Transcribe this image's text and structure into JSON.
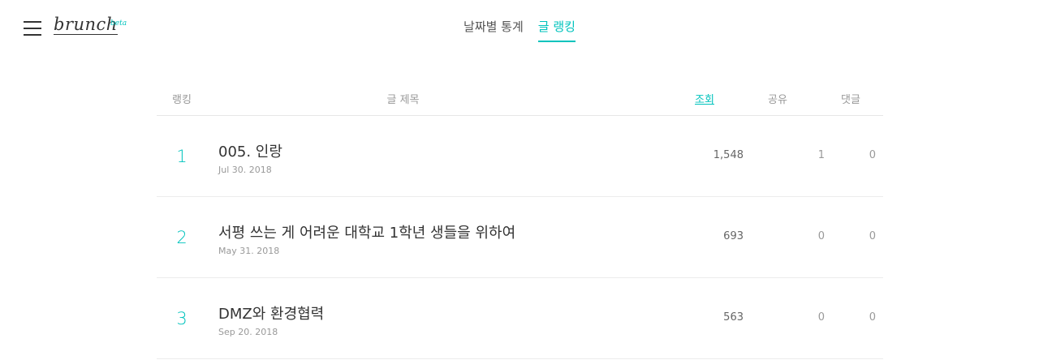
{
  "header": {
    "logo_text": "brunch",
    "logo_badge": "beta",
    "menu_icon": "hamburger-menu-icon",
    "tabs": [
      {
        "label": "날짜별 통계",
        "active": false
      },
      {
        "label": "글 랭킹",
        "active": true
      }
    ]
  },
  "table": {
    "columns": {
      "rank": "랭킹",
      "title": "글 제목",
      "views": "조회",
      "shares": "공유",
      "comments": "댓글"
    },
    "rows": [
      {
        "rank": "1",
        "title": "005. 인랑",
        "date": "Jul 30. 2018",
        "views": "1,548",
        "shares": "1",
        "comments": "0"
      },
      {
        "rank": "2",
        "title": "서평 쓰는 게 어려운 대학교 1학년 생들을 위하여",
        "date": "May 31. 2018",
        "views": "693",
        "shares": "0",
        "comments": "0"
      },
      {
        "rank": "3",
        "title": "DMZ와 환경협력",
        "date": "Sep 20. 2018",
        "views": "563",
        "shares": "0",
        "comments": "0"
      }
    ]
  },
  "colors": {
    "accent": "#00c3bd",
    "text": "#333333",
    "muted": "#999999",
    "divider": "#e6e6e6"
  }
}
